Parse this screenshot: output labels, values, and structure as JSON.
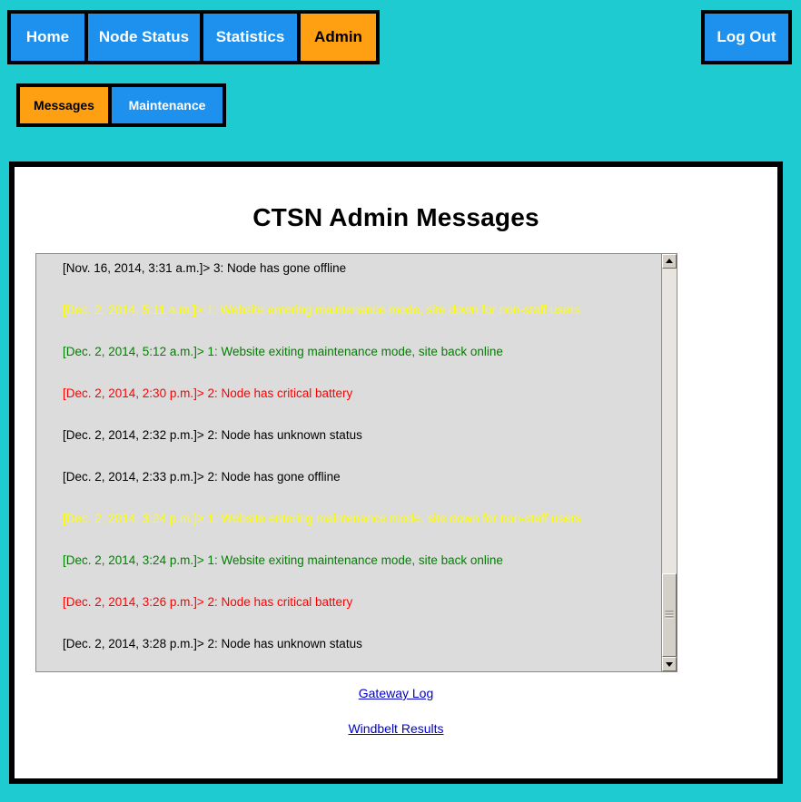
{
  "theme": {
    "page_background": "#1ecbd1",
    "nav_inactive": "#1e90ee",
    "nav_active": "#ffa012",
    "panel_background": "#ffffff",
    "border": "#000000",
    "list_background": "#dcdcdc",
    "link_color": "#0000cc",
    "msg_black": "#000000",
    "msg_yellow": "#ffff00",
    "msg_green": "#008000",
    "msg_red": "#ff0000"
  },
  "main_nav": {
    "items": [
      {
        "label": "Home",
        "active": false
      },
      {
        "label": "Node Status",
        "active": false
      },
      {
        "label": "Statistics",
        "active": false
      },
      {
        "label": "Admin",
        "active": true
      }
    ],
    "logout_label": "Log Out"
  },
  "sub_nav": {
    "items": [
      {
        "label": "Messages",
        "active": true
      },
      {
        "label": "Maintenance",
        "active": false
      }
    ]
  },
  "panel": {
    "title": "CTSN Admin Messages",
    "links": [
      {
        "label": "Gateway Log"
      },
      {
        "label": "Windbelt Results"
      }
    ]
  },
  "messages": {
    "items": [
      {
        "text": "[Nov. 16, 2014, 3:31 a.m.]> 3: Node has gone offline",
        "timestamp": "Nov. 16, 2014, 3:31 a.m.",
        "node": "3",
        "body": "Node has gone offline",
        "severity": "black"
      },
      {
        "text": "[Dec. 2, 2014, 5:11 a.m.]> 1: Website entering maintenance mode, site down for non-staff users",
        "timestamp": "Dec. 2, 2014, 5:11 a.m.",
        "node": "1",
        "body": "Website entering maintenance mode, site down for non-staff users",
        "severity": "yellow"
      },
      {
        "text": "[Dec. 2, 2014, 5:12 a.m.]> 1: Website exiting maintenance mode, site back online",
        "timestamp": "Dec. 2, 2014, 5:12 a.m.",
        "node": "1",
        "body": "Website exiting maintenance mode, site back online",
        "severity": "green"
      },
      {
        "text": "[Dec. 2, 2014, 2:30 p.m.]> 2: Node has critical battery",
        "timestamp": "Dec. 2, 2014, 2:30 p.m.",
        "node": "2",
        "body": "Node has critical battery",
        "severity": "red"
      },
      {
        "text": "[Dec. 2, 2014, 2:32 p.m.]> 2: Node has unknown status",
        "timestamp": "Dec. 2, 2014, 2:32 p.m.",
        "node": "2",
        "body": "Node has unknown status",
        "severity": "black"
      },
      {
        "text": "[Dec. 2, 2014, 2:33 p.m.]> 2: Node has gone offline",
        "timestamp": "Dec. 2, 2014, 2:33 p.m.",
        "node": "2",
        "body": "Node has gone offline",
        "severity": "black"
      },
      {
        "text": "[Dec. 2, 2014, 3:24 p.m.]> 1: Website entering maintenance mode, site down for non-staff users",
        "timestamp": "Dec. 2, 2014, 3:24 p.m.",
        "node": "1",
        "body": "Website entering maintenance mode, site down for non-staff users",
        "severity": "yellow"
      },
      {
        "text": "[Dec. 2, 2014, 3:24 p.m.]> 1: Website exiting maintenance mode, site back online",
        "timestamp": "Dec. 2, 2014, 3:24 p.m.",
        "node": "1",
        "body": "Website exiting maintenance mode, site back online",
        "severity": "green"
      },
      {
        "text": "[Dec. 2, 2014, 3:26 p.m.]> 2: Node has critical battery",
        "timestamp": "Dec. 2, 2014, 3:26 p.m.",
        "node": "2",
        "body": "Node has critical battery",
        "severity": "red"
      },
      {
        "text": "[Dec. 2, 2014, 3:28 p.m.]> 2: Node has unknown status",
        "timestamp": "Dec. 2, 2014, 3:28 p.m.",
        "node": "2",
        "body": "Node has unknown status",
        "severity": "black"
      }
    ]
  },
  "scrollbar": {
    "up_icon": "triangle-up-icon",
    "down_icon": "triangle-down-icon",
    "thumb_position": "bottom"
  }
}
